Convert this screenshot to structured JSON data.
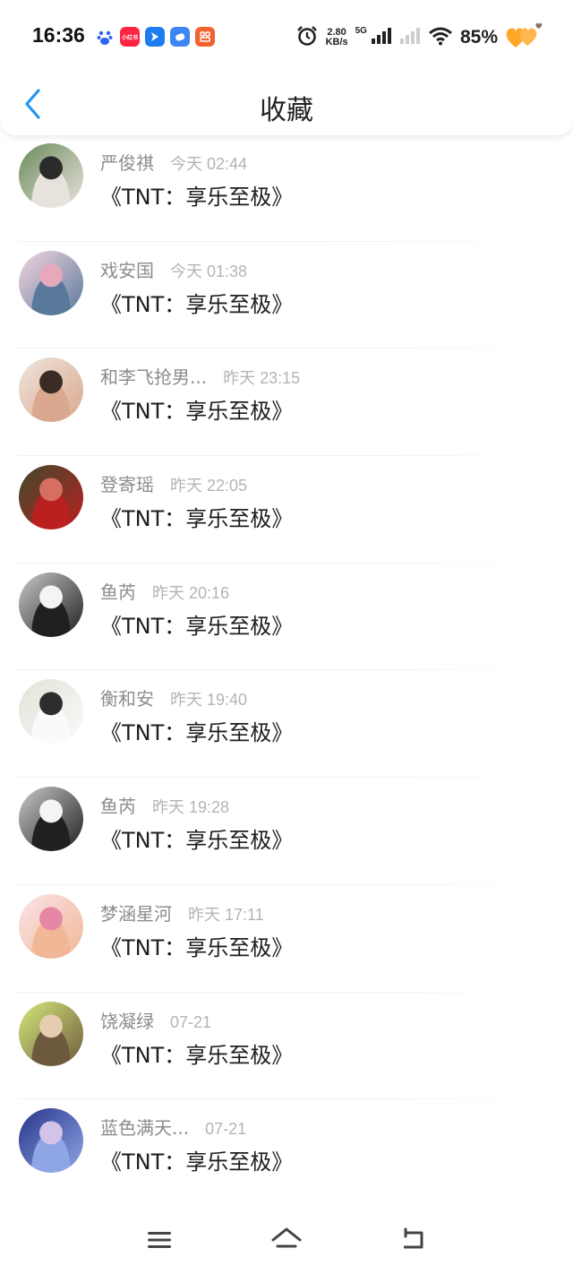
{
  "status_bar": {
    "time": "16:36",
    "net_speed_value": "2.80",
    "net_speed_unit": "KB/s",
    "network_type": "5G",
    "battery_percent": "85%",
    "app_icons": [
      {
        "icon": "baidu-icon",
        "color": "#2f65f2",
        "label": ""
      },
      {
        "icon": "xiaohongshu-icon",
        "color": "#ff2442",
        "label": "小红书"
      },
      {
        "icon": "arrow-app-icon",
        "color": "#1e7cf0",
        "label": ""
      },
      {
        "icon": "blue-app-icon",
        "color": "#3d86f5",
        "label": ""
      },
      {
        "icon": "orange-app-icon",
        "color": "#f2622e",
        "label": ""
      }
    ]
  },
  "header": {
    "title": "收藏",
    "back_icon": "chevron-left-icon",
    "accent_color": "#2196f3"
  },
  "favorites": [
    {
      "name": "严俊祺",
      "time": "今天 02:44",
      "content": "《TNT：享乐至极》",
      "avatar_colors": [
        "#6b8b5c",
        "#e8e2dc",
        "#2b2b2b"
      ]
    },
    {
      "name": "戏安国",
      "time": "今天 01:38",
      "content": "《TNT：享乐至极》",
      "avatar_colors": [
        "#f6d6e0",
        "#58799a",
        "#e7a8bc"
      ]
    },
    {
      "name": "和李飞抢男...",
      "time": "昨天 23:15",
      "content": "《TNT：享乐至极》",
      "avatar_colors": [
        "#efe5dc",
        "#d9a88e",
        "#3c2b25"
      ]
    },
    {
      "name": "登寄瑶",
      "time": "昨天 22:05",
      "content": "《TNT：享乐至极》",
      "avatar_colors": [
        "#3f4a2c",
        "#b9201f",
        "#d66f62"
      ]
    },
    {
      "name": "鱼芮",
      "time": "昨天 20:16",
      "content": "《TNT：享乐至极》",
      "avatar_colors": [
        "#c9c9c9",
        "#202020",
        "#f4f4f4"
      ]
    },
    {
      "name": "衡和安",
      "time": "昨天 19:40",
      "content": "《TNT：享乐至极》",
      "avatar_colors": [
        "#dfe4d6",
        "#fafafa",
        "#2d2d2d"
      ]
    },
    {
      "name": "鱼芮",
      "time": "昨天 19:28",
      "content": "《TNT：享乐至极》",
      "avatar_colors": [
        "#c9c9c9",
        "#202020",
        "#f4f4f4"
      ]
    },
    {
      "name": "梦涵星河",
      "time": "昨天 17:11",
      "content": "《TNT：享乐至极》",
      "avatar_colors": [
        "#fbe3e8",
        "#f0b896",
        "#e687a6"
      ]
    },
    {
      "name": "饶凝绿",
      "time": "07-21",
      "content": "《TNT：享乐至极》",
      "avatar_colors": [
        "#d6e87a",
        "#6d5a3e",
        "#e6cdb2"
      ]
    },
    {
      "name": "蓝色满天...",
      "time": "07-21",
      "content": "《TNT：享乐至极》",
      "avatar_colors": [
        "#27358a",
        "#8fa6e6",
        "#d4c3e8"
      ]
    }
  ],
  "nav_bar": {
    "menu_icon": "menu-icon",
    "home_icon": "home-icon",
    "back_icon": "back-icon"
  }
}
